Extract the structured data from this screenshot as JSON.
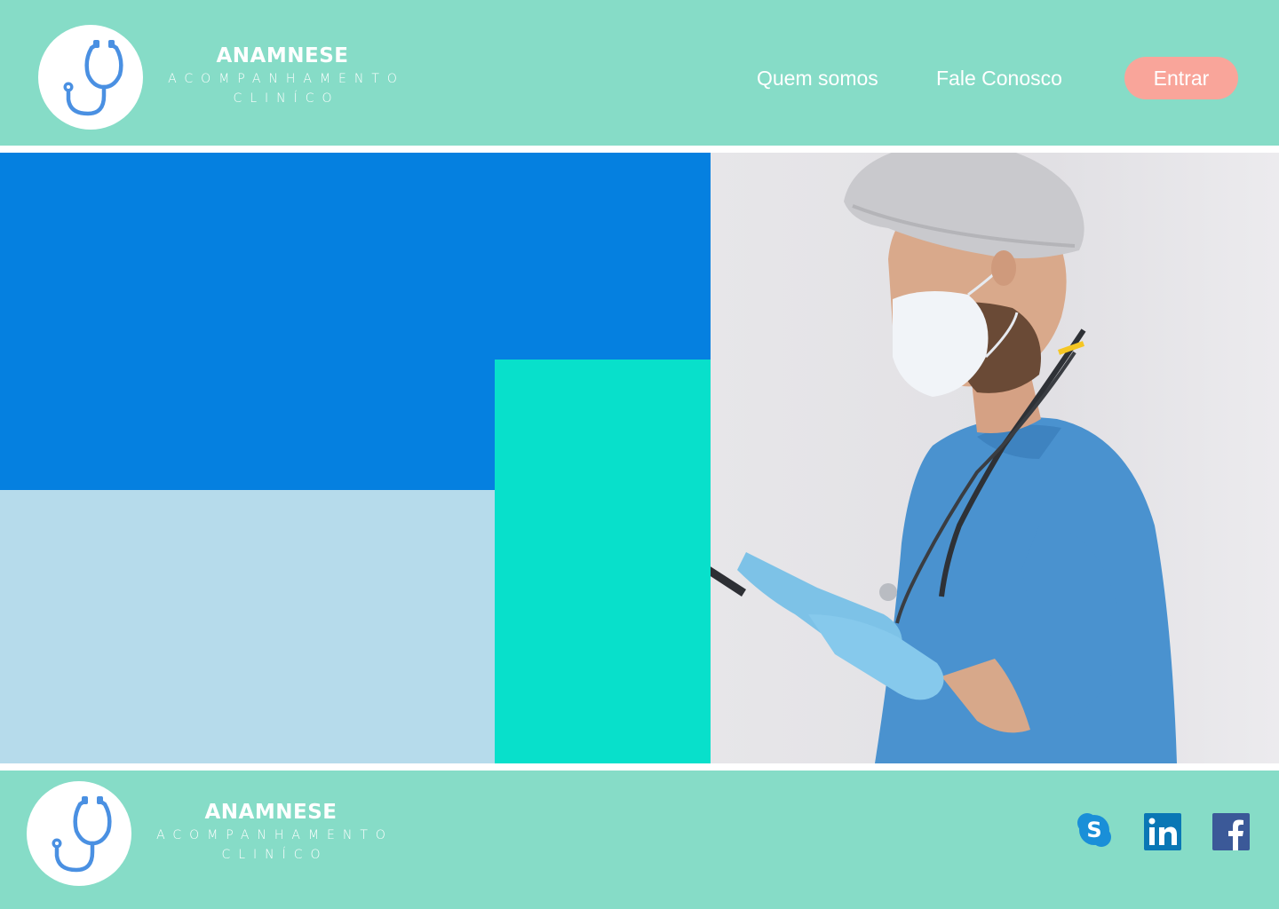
{
  "header": {
    "brand_title": "ANAMNESE",
    "brand_sub_1": "ACOMPANHAMENTO",
    "brand_sub_2": "CLINÍCO",
    "nav": [
      "Quem somos",
      "Fale Conosco"
    ],
    "login_label": "Entrar"
  },
  "hero": {
    "image": "doctor-with-tablet-photo"
  },
  "footer": {
    "brand_title": "ANAMNESE",
    "brand_sub_1": "ACOMPANHAMENTO",
    "brand_sub_2": "CLINÍCO",
    "social": [
      {
        "name": "skype-icon",
        "letter": "S"
      },
      {
        "name": "linkedin-icon",
        "letter": "in"
      },
      {
        "name": "facebook-icon",
        "letter": "f"
      }
    ]
  },
  "colors": {
    "bar": "#86dcc7",
    "button": "#f9a59a",
    "hero_blue": "#0580e0",
    "hero_light": "#b6dbeb",
    "hero_teal": "#08e0cb",
    "skype": "#1a8fd8",
    "linkedin": "#0a77b5",
    "facebook": "#3b5998"
  }
}
